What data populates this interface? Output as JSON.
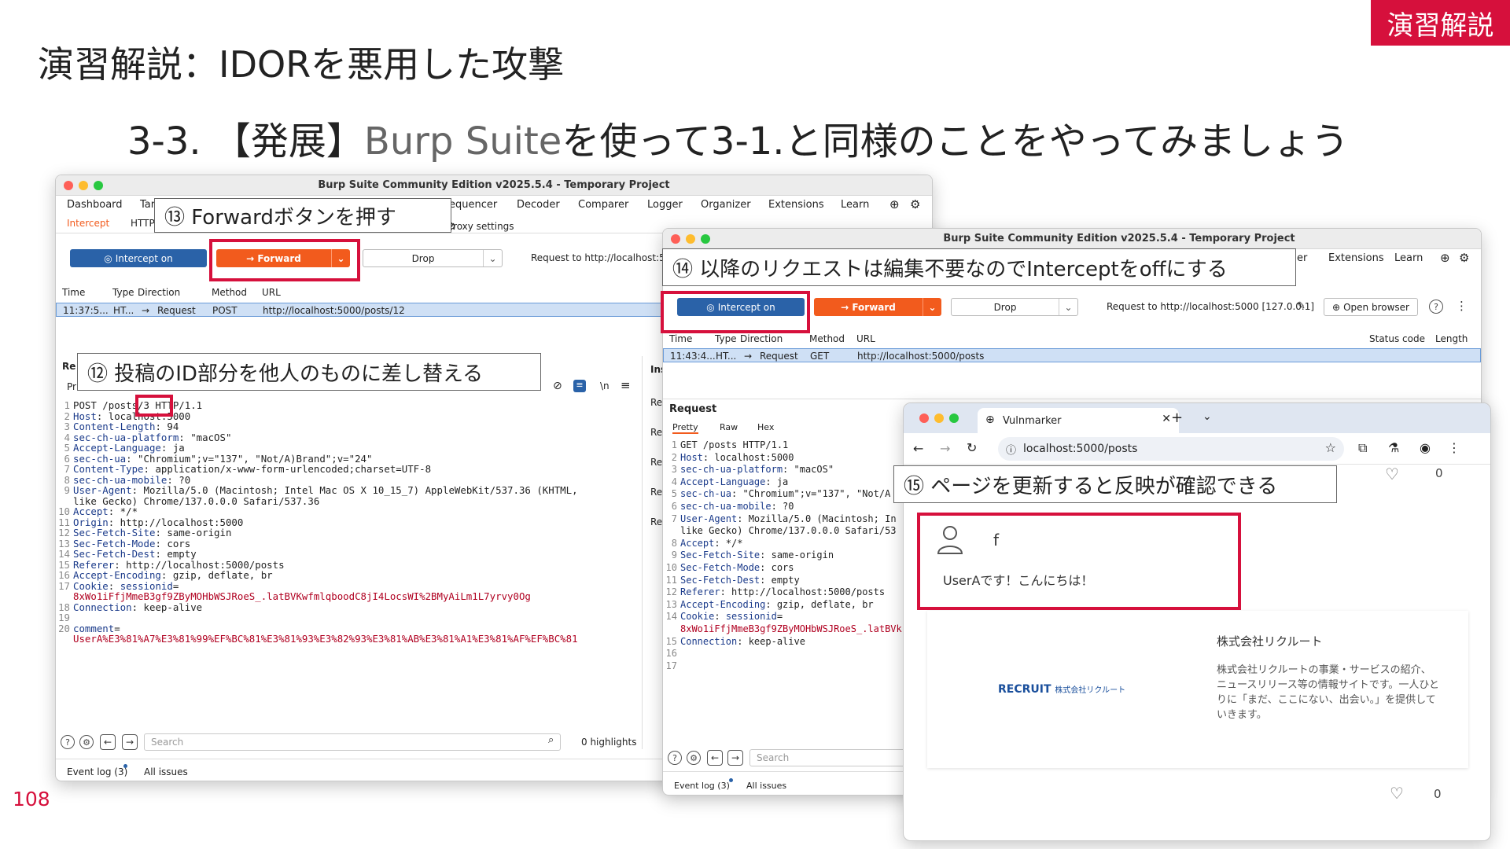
{
  "slide": {
    "badge": "演習解説",
    "title": "演習解説：IDORを悪用した攻撃",
    "subtitle_prefix": "3-3. 【発展】",
    "subtitle_gray": "Burp Suite",
    "subtitle_suffix": "を使って3-1.と同様のことをやってみましょう",
    "page_number": "108"
  },
  "callouts": {
    "c12": "⑫ 投稿のID部分を他人のものに差し替える",
    "c13": "⑬ Forwardボタンを押す",
    "c14": "⑭ 以降のリクエストは編集不要なのでInterceptをoffにする",
    "c15": "⑮ ページを更新すると反映が確認できる"
  },
  "burp1": {
    "title": "Burp Suite Community Edition v2025.5.4 - Temporary Project",
    "menu": [
      "Dashboard",
      "Tar",
      "equencer",
      "Decoder",
      "Comparer",
      "Logger",
      "Organizer",
      "Extensions",
      "Learn"
    ],
    "subtabs": {
      "intercept": "Intercept",
      "http": "HTTP",
      "proxy_settings": "Proxy settings"
    },
    "intercept_btn": "Intercept on",
    "forward_btn": "Forward",
    "drop_btn": "Drop",
    "request_to": "Request to http://localhost:5(",
    "columns": {
      "time": "Time",
      "type": "Type",
      "direction": "Direction",
      "method": "Method",
      "url": "URL"
    },
    "row": {
      "time": "11:37:5...",
      "type": "HT...",
      "direction": "Request",
      "method": "POST",
      "url": "http://localhost:5000/posts/12"
    },
    "request_label": "Re",
    "pretty_label": "Pr",
    "inspector_label": "Ins",
    "inspector_items": [
      "Re",
      "Re",
      "Re",
      "Re",
      "Re"
    ],
    "newline_label": "\\n",
    "code": [
      {
        "n": "1",
        "parts": [
          [
            "v",
            "POST /posts/3 HTTP/1.1"
          ]
        ]
      },
      {
        "n": "2",
        "parts": [
          [
            "k",
            "Host"
          ],
          [
            "v",
            ": localhost:5000"
          ]
        ]
      },
      {
        "n": "3",
        "parts": [
          [
            "k",
            "Content-Length"
          ],
          [
            "v",
            ": 94"
          ]
        ]
      },
      {
        "n": "4",
        "parts": [
          [
            "k",
            "sec-ch-ua-platform"
          ],
          [
            "v",
            ": \"macOS\""
          ]
        ]
      },
      {
        "n": "5",
        "parts": [
          [
            "k",
            "Accept-Language"
          ],
          [
            "v",
            ": ja"
          ]
        ]
      },
      {
        "n": "6",
        "parts": [
          [
            "k",
            "sec-ch-ua"
          ],
          [
            "v",
            ": \"Chromium\";v=\"137\", \"Not/A)Brand\";v=\"24\""
          ]
        ]
      },
      {
        "n": "7",
        "parts": [
          [
            "k",
            "Content-Type"
          ],
          [
            "v",
            ": application/x-www-form-urlencoded;charset=UTF-8"
          ]
        ]
      },
      {
        "n": "8",
        "parts": [
          [
            "k",
            "sec-ch-ua-mobile"
          ],
          [
            "v",
            ": ?0"
          ]
        ]
      },
      {
        "n": "9",
        "parts": [
          [
            "k",
            "User-Agent"
          ],
          [
            "v",
            ": Mozilla/5.0 (Macintosh; Intel Mac OS X 10_15_7) AppleWebKit/537.36 (KHTML,"
          ]
        ]
      },
      {
        "n": "",
        "parts": [
          [
            "v",
            "like Gecko) Chrome/137.0.0.0 Safari/537.36"
          ]
        ]
      },
      {
        "n": "10",
        "parts": [
          [
            "k",
            "Accept"
          ],
          [
            "v",
            ": */*"
          ]
        ]
      },
      {
        "n": "11",
        "parts": [
          [
            "k",
            "Origin"
          ],
          [
            "v",
            ": http://localhost:5000"
          ]
        ]
      },
      {
        "n": "12",
        "parts": [
          [
            "k",
            "Sec-Fetch-Site"
          ],
          [
            "v",
            ": same-origin"
          ]
        ]
      },
      {
        "n": "13",
        "parts": [
          [
            "k",
            "Sec-Fetch-Mode"
          ],
          [
            "v",
            ": cors"
          ]
        ]
      },
      {
        "n": "14",
        "parts": [
          [
            "k",
            "Sec-Fetch-Dest"
          ],
          [
            "v",
            ": empty"
          ]
        ]
      },
      {
        "n": "15",
        "parts": [
          [
            "k",
            "Referer"
          ],
          [
            "v",
            ": http://localhost:5000/posts"
          ]
        ]
      },
      {
        "n": "16",
        "parts": [
          [
            "k",
            "Accept-Encoding"
          ],
          [
            "v",
            ": gzip, deflate, br"
          ]
        ]
      },
      {
        "n": "17",
        "parts": [
          [
            "k",
            "Cookie"
          ],
          [
            "v",
            ": "
          ],
          [
            "k",
            "sessionid"
          ],
          [
            "v",
            "="
          ]
        ]
      },
      {
        "n": "",
        "parts": [
          [
            "r",
            "8xWo1iFfjMmeB3gf9ZByMOHbWSJRoeS_.latBVKwfmlqboodC8jI4LocsWI%2BMyAiLm1L7yrvy0Og"
          ]
        ]
      },
      {
        "n": "18",
        "parts": [
          [
            "k",
            "Connection"
          ],
          [
            "v",
            ": keep-alive"
          ]
        ]
      },
      {
        "n": "19",
        "parts": []
      },
      {
        "n": "20",
        "parts": [
          [
            "k",
            "comment"
          ],
          [
            "v",
            "="
          ]
        ]
      },
      {
        "n": "",
        "parts": [
          [
            "r",
            "UserA%E3%81%A7%E3%81%99%EF%BC%81%E3%81%93%E3%82%93%E3%81%AB%E3%81%A1%E3%81%AF%EF%BC%81"
          ]
        ]
      }
    ],
    "search_placeholder": "Search",
    "highlights": "0 highlights",
    "event_log": "Event log (3)",
    "all_issues": "All issues"
  },
  "burp2": {
    "title": "Burp Suite Community Edition v2025.5.4 - Temporary Project",
    "menu": [
      "er",
      "Extensions",
      "Learn"
    ],
    "intercept_btn": "Intercept on",
    "forward_btn": "Forward",
    "drop_btn": "Drop",
    "request_to": "Request to http://localhost:5000  [127.0.0.1]",
    "open_browser": "Open browser",
    "columns": {
      "time": "Time",
      "type": "Type",
      "direction": "Direction",
      "method": "Method",
      "url": "URL",
      "status": "Status code",
      "length": "Length"
    },
    "row": {
      "time": "11:43:4...",
      "type": "HT...",
      "direction": "Request",
      "method": "GET",
      "url": "http://localhost:5000/posts"
    },
    "request_heading": "Request",
    "tabs": [
      "Pretty",
      "Raw",
      "Hex"
    ],
    "code": [
      {
        "n": "1",
        "parts": [
          [
            "v",
            "GET /posts HTTP/1.1"
          ]
        ]
      },
      {
        "n": "2",
        "parts": [
          [
            "k",
            "Host"
          ],
          [
            "v",
            ": localhost:5000"
          ]
        ]
      },
      {
        "n": "3",
        "parts": [
          [
            "k",
            "sec-ch-ua-platform"
          ],
          [
            "v",
            ": \"macOS\""
          ]
        ]
      },
      {
        "n": "4",
        "parts": [
          [
            "k",
            "Accept-Language"
          ],
          [
            "v",
            ": ja"
          ]
        ]
      },
      {
        "n": "5",
        "parts": [
          [
            "k",
            "sec-ch-ua"
          ],
          [
            "v",
            ": \"Chromium\";v=\"137\", \"Not/A"
          ]
        ]
      },
      {
        "n": "6",
        "parts": [
          [
            "k",
            "sec-ch-ua-mobile"
          ],
          [
            "v",
            ": ?0"
          ]
        ]
      },
      {
        "n": "7",
        "parts": [
          [
            "k",
            "User-Agent"
          ],
          [
            "v",
            ": Mozilla/5.0 (Macintosh; In"
          ]
        ]
      },
      {
        "n": "",
        "parts": [
          [
            "v",
            "like Gecko) Chrome/137.0.0.0 Safari/53"
          ]
        ]
      },
      {
        "n": "8",
        "parts": [
          [
            "k",
            "Accept"
          ],
          [
            "v",
            ": */*"
          ]
        ]
      },
      {
        "n": "9",
        "parts": [
          [
            "k",
            "Sec-Fetch-Site"
          ],
          [
            "v",
            ": same-origin"
          ]
        ]
      },
      {
        "n": "10",
        "parts": [
          [
            "k",
            "Sec-Fetch-Mode"
          ],
          [
            "v",
            ": cors"
          ]
        ]
      },
      {
        "n": "11",
        "parts": [
          [
            "k",
            "Sec-Fetch-Dest"
          ],
          [
            "v",
            ": empty"
          ]
        ]
      },
      {
        "n": "12",
        "parts": [
          [
            "k",
            "Referer"
          ],
          [
            "v",
            ": http://localhost:5000/posts"
          ]
        ]
      },
      {
        "n": "13",
        "parts": [
          [
            "k",
            "Accept-Encoding"
          ],
          [
            "v",
            ": gzip, deflate, br"
          ]
        ]
      },
      {
        "n": "14",
        "parts": [
          [
            "k",
            "Cookie"
          ],
          [
            "v",
            ": "
          ],
          [
            "k",
            "sessionid"
          ],
          [
            "v",
            "="
          ]
        ]
      },
      {
        "n": "",
        "parts": [
          [
            "r",
            "8xWo1iFfjMmeB3gf9ZByMOHbWSJRoeS_.latBVk"
          ]
        ]
      },
      {
        "n": "15",
        "parts": [
          [
            "k",
            "Connection"
          ],
          [
            "v",
            ": keep-alive"
          ]
        ]
      },
      {
        "n": "16",
        "parts": []
      },
      {
        "n": "17",
        "parts": []
      }
    ],
    "search_placeholder": "Search",
    "event_log": "Event log (3)",
    "all_issues": "All issues"
  },
  "browser": {
    "tab_title": "Vulnmarker",
    "url": "localhost:5000/posts",
    "top_like_count": "0",
    "post_user": "f",
    "post_text": "UserAです！こんにちは！",
    "company_name": "株式会社リクルート",
    "company_desc": [
      "株式会社リクルートの事業・サービスの紹介、",
      "ニュースリリース等の情報サイトです。一人ひと",
      "りに「まだ、ここにない、出会い。」を提供して",
      "いきます。"
    ],
    "logo_text": "RECRUIT",
    "logo_sub": "株式会社リクルート",
    "bottom_like_count": "0"
  },
  "colors": {
    "accent": "#d6103c",
    "forward": "#f25b1d",
    "intercept": "#2a62a8"
  }
}
